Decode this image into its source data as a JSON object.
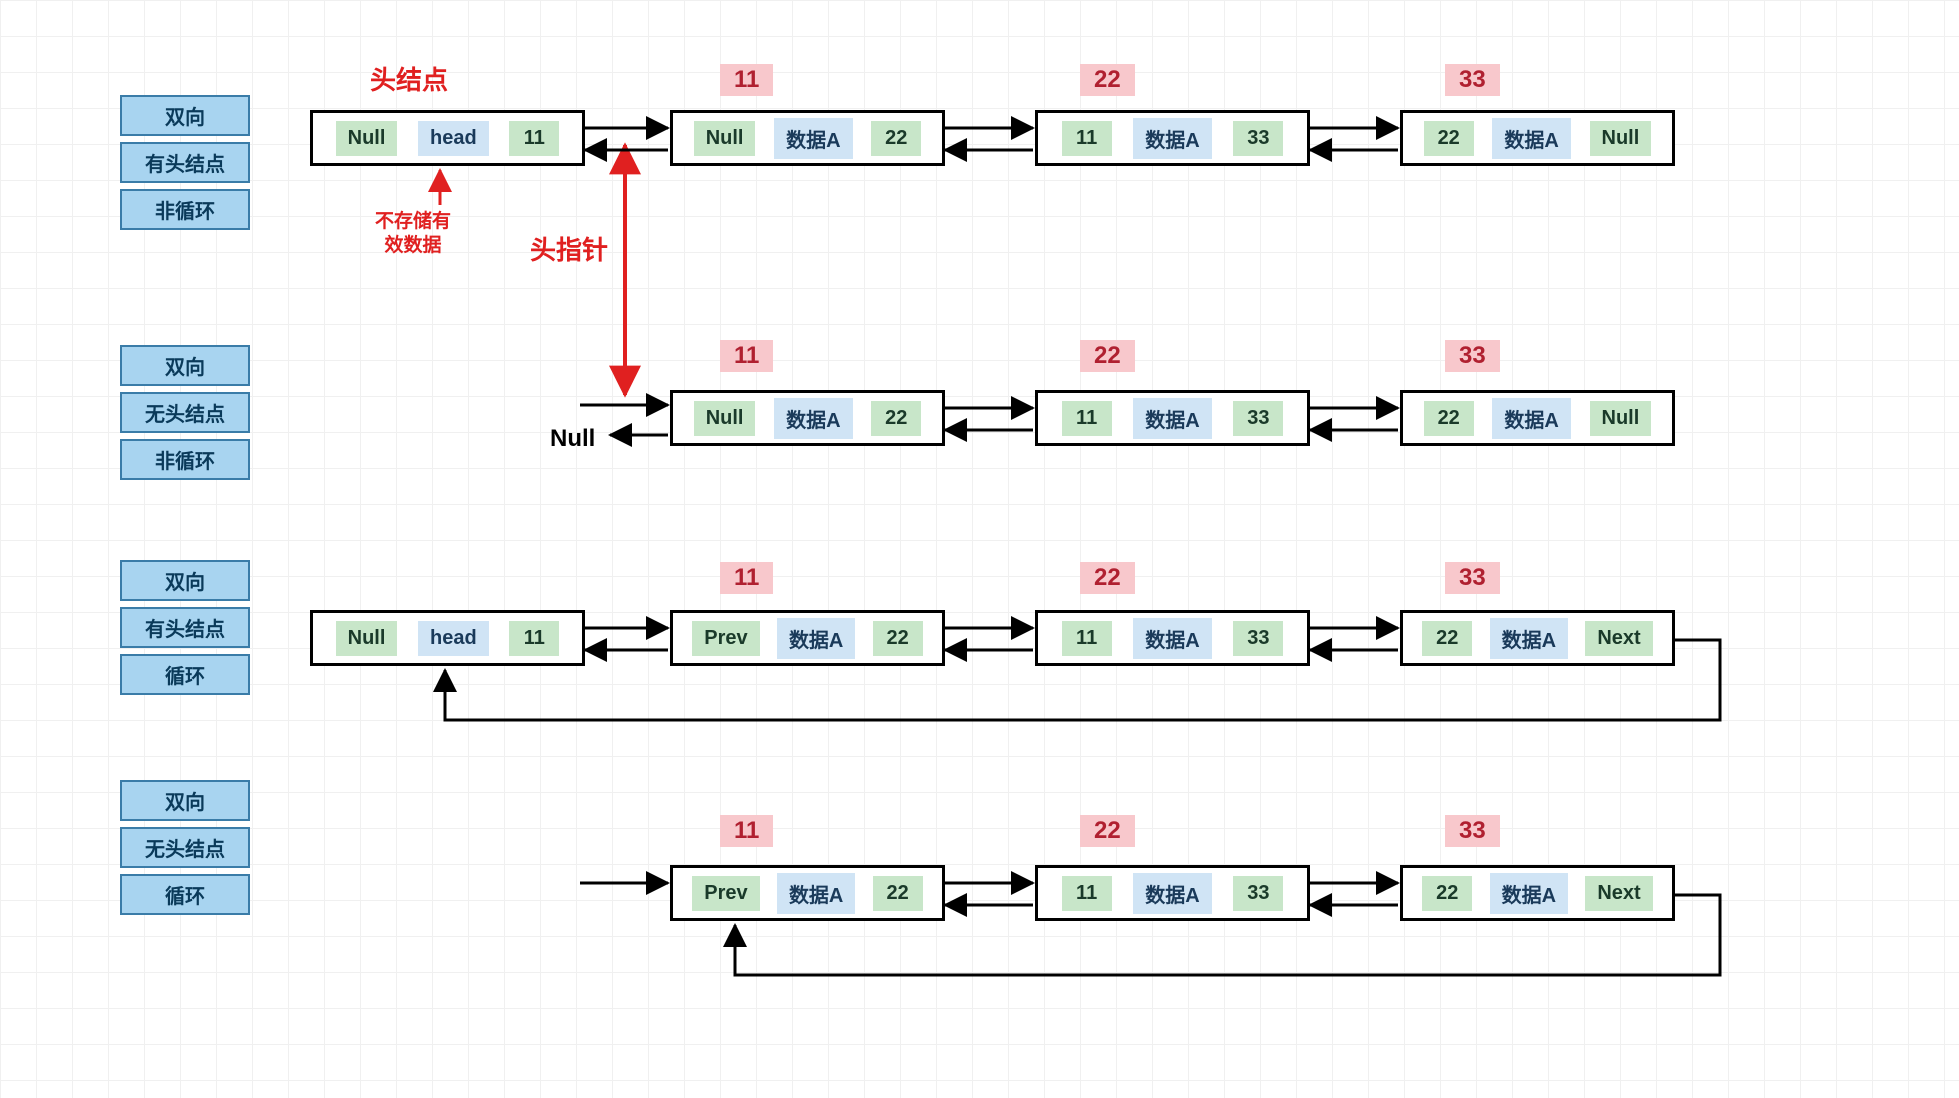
{
  "annotations": {
    "head_node": "头结点",
    "head_pointer": "头指针",
    "invalid_data": "不存储有\n效数据",
    "null_word": "Null"
  },
  "groups": [
    {
      "tags": [
        "双向",
        "有头结点",
        "非循环"
      ],
      "head": {
        "prev": "Null",
        "data": "head",
        "next": "11"
      },
      "head_label": null,
      "nodes": [
        {
          "label": "11",
          "prev": "Null",
          "data": "数据A",
          "next": "22"
        },
        {
          "label": "22",
          "prev": "11",
          "data": "数据A",
          "next": "33"
        },
        {
          "label": "33",
          "prev": "22",
          "data": "数据A",
          "next": "Null"
        }
      ]
    },
    {
      "tags": [
        "双向",
        "无头结点",
        "非循环"
      ],
      "head": null,
      "nodes": [
        {
          "label": "11",
          "prev": "Null",
          "data": "数据A",
          "next": "22"
        },
        {
          "label": "22",
          "prev": "11",
          "data": "数据A",
          "next": "33"
        },
        {
          "label": "33",
          "prev": "22",
          "data": "数据A",
          "next": "Null"
        }
      ]
    },
    {
      "tags": [
        "双向",
        "有头结点",
        "循环"
      ],
      "head": {
        "prev": "Null",
        "data": "head",
        "next": "11"
      },
      "nodes": [
        {
          "label": "11",
          "prev": "Prev",
          "data": "数据A",
          "next": "22"
        },
        {
          "label": "22",
          "prev": "11",
          "data": "数据A",
          "next": "33"
        },
        {
          "label": "33",
          "prev": "22",
          "data": "数据A",
          "next": "Next"
        }
      ]
    },
    {
      "tags": [
        "双向",
        "无头结点",
        "循环"
      ],
      "head": null,
      "nodes": [
        {
          "label": "11",
          "prev": "Prev",
          "data": "数据A",
          "next": "22"
        },
        {
          "label": "22",
          "prev": "11",
          "data": "数据A",
          "next": "33"
        },
        {
          "label": "33",
          "prev": "22",
          "data": "数据A",
          "next": "Next"
        }
      ]
    }
  ]
}
